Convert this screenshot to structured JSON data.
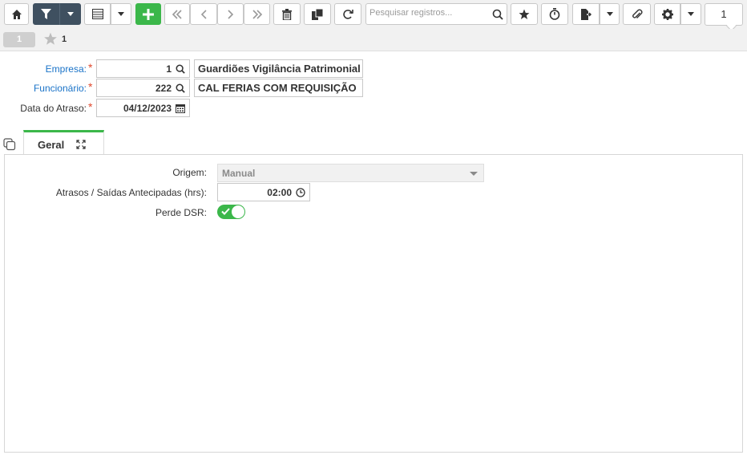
{
  "toolbar": {
    "search_placeholder": "Pesquisar registros...",
    "page_number": "1",
    "icons": [
      "home-icon",
      "filter-icon",
      "chevron-down-icon",
      "grid-icon",
      "chevron-down-icon",
      "plus-icon",
      "first-icon",
      "prev-icon",
      "next-icon",
      "last-icon",
      "trash-icon",
      "copy-icon",
      "refresh-icon",
      "search-icon",
      "star-icon",
      "timer-icon",
      "export-icon",
      "chevron-down-icon",
      "attachment-icon",
      "gear-icon",
      "chevron-down-icon"
    ],
    "accent_dark": "#3f5060",
    "accent_green": "#3bb74a"
  },
  "subbar": {
    "record_number": "1",
    "favorites_count": "1"
  },
  "form": {
    "empresa": {
      "label": "Empresa:",
      "code": "1",
      "description": "Guardiões Vigilância Patrimonial"
    },
    "funcionario": {
      "label": "Funcionário:",
      "code": "222",
      "description": "CAL FERIAS COM REQUISIÇÃO"
    },
    "data_atraso": {
      "label": "Data do Atraso:",
      "value": "04/12/2023"
    },
    "required_mark": "*"
  },
  "tabs": [
    {
      "label": "Geral"
    }
  ],
  "geral": {
    "origem": {
      "label": "Origem:",
      "value": "Manual"
    },
    "atrasos": {
      "label": "Atrasos / Saídas Antecipadas (hrs):",
      "value": "02:00"
    },
    "perde_dsr": {
      "label": "Perde DSR:",
      "checked": true
    }
  }
}
